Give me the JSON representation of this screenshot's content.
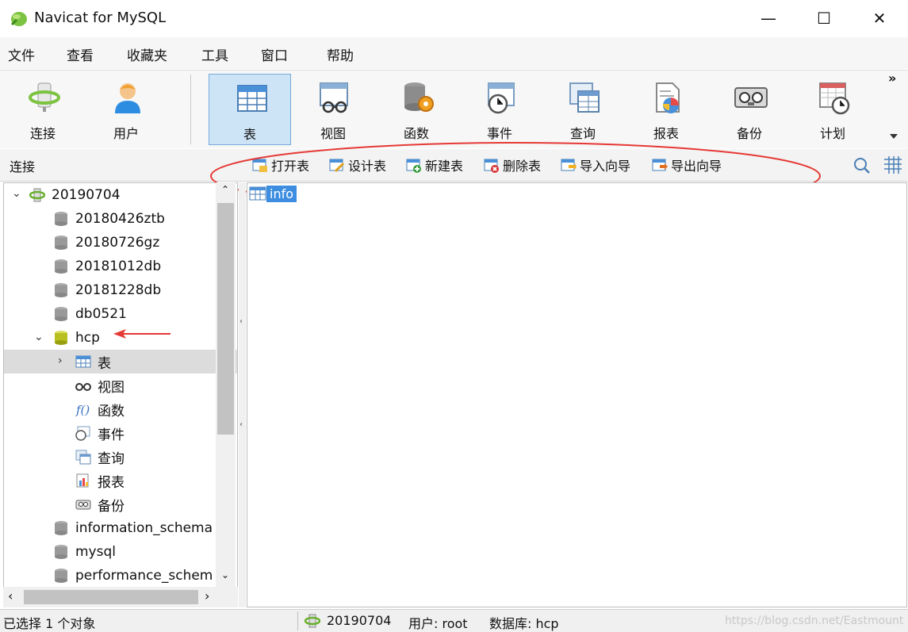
{
  "window": {
    "title": "Navicat for MySQL",
    "controls": {
      "minimize": "—",
      "maximize": "☐",
      "close": "✕"
    }
  },
  "menu": [
    "文件",
    "查看",
    "收藏夹",
    "工具",
    "窗口",
    "帮助"
  ],
  "toolbar": {
    "left": [
      {
        "label": "连接",
        "icon": "connection-icon"
      },
      {
        "label": "用户",
        "icon": "user-icon"
      }
    ],
    "right": [
      {
        "label": "表",
        "icon": "table-icon",
        "active": true
      },
      {
        "label": "视图",
        "icon": "view-icon"
      },
      {
        "label": "函数",
        "icon": "function-icon"
      },
      {
        "label": "事件",
        "icon": "event-icon"
      },
      {
        "label": "查询",
        "icon": "query-icon"
      },
      {
        "label": "报表",
        "icon": "report-icon"
      },
      {
        "label": "备份",
        "icon": "backup-icon"
      },
      {
        "label": "计划",
        "icon": "schedule-icon"
      }
    ],
    "overflow": "»"
  },
  "subbar": {
    "section_label": "连接",
    "actions": [
      "打开表",
      "设计表",
      "新建表",
      "删除表",
      "导入向导",
      "导出向导"
    ]
  },
  "tree": {
    "connection": "20190704",
    "databases_top": [
      "20180426ztb",
      "20180726gz",
      "20181012db",
      "20181228db",
      "db0521"
    ],
    "open_db": "hcp",
    "children": [
      "表",
      "视图",
      "函数",
      "事件",
      "查询",
      "报表",
      "备份"
    ],
    "databases_bottom": [
      "information_schema",
      "mysql",
      "performance_schem"
    ]
  },
  "content": {
    "tables": [
      "info"
    ]
  },
  "status": {
    "selection": "已选择 1 个对象",
    "connection": "20190704",
    "user": "用户: root",
    "database": "数据库: hcp",
    "watermark": "https://blog.csdn.net/Eastmount"
  },
  "colors": {
    "active_button": "#cde4f7",
    "annotation_red": "#e53935",
    "selection_blue": "#3d8ee0"
  }
}
